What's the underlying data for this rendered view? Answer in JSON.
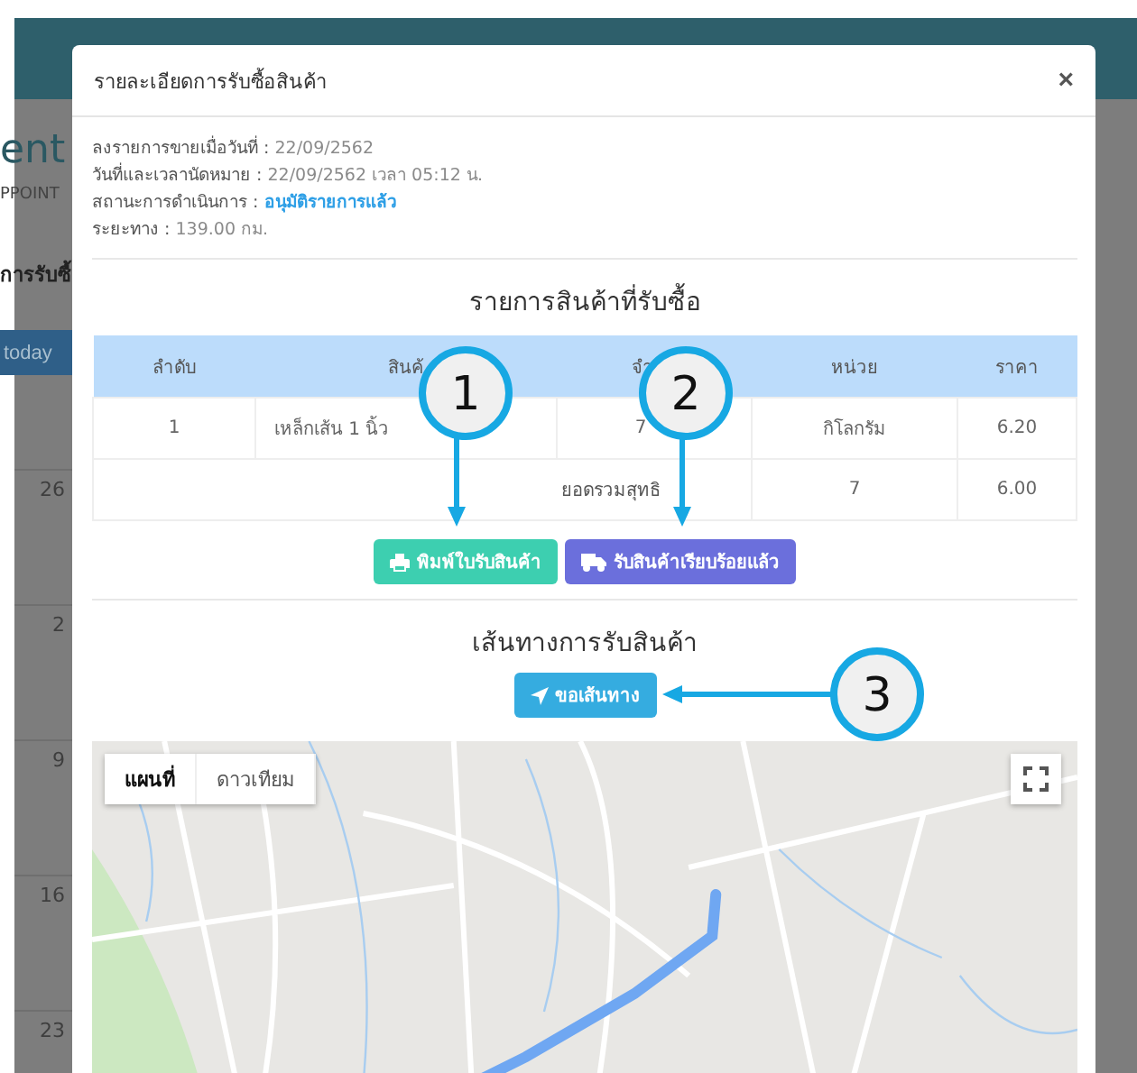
{
  "background_page": {
    "title_fragment": "ent",
    "subtitle_fragment": "PPOINT",
    "heading_fragment": "การรับซื้",
    "today_button": "today",
    "calendar_days": [
      "26",
      "2",
      "9",
      "16",
      "23"
    ]
  },
  "modal": {
    "title": "รายละเอียดการรับซื้อสินค้า",
    "close": "×",
    "info": [
      {
        "label": "ลงรายการขายเมื่อวันที่ :",
        "value": "22/09/2562",
        "kind": "text"
      },
      {
        "label": "วันที่และเวลานัดหมาย :",
        "value": "22/09/2562 เวลา 05:12 น.",
        "kind": "text"
      },
      {
        "label": "สถานะการดำเนินการ :",
        "value": "อนุมัติรายการแล้ว",
        "kind": "status"
      },
      {
        "label": "ระยะทาง :",
        "value": "139.00 กม.",
        "kind": "text"
      }
    ],
    "items_title": "รายการสินค้าที่รับซื้อ",
    "table": {
      "columns": [
        "ลำดับ",
        "สินค้",
        "จำ",
        "หน่วย",
        "ราคา"
      ],
      "rows": [
        {
          "cells": [
            "1",
            "เหล็กเส้น 1 นิ้ว",
            "7",
            "กิโลกรัม",
            "6.20"
          ]
        }
      ],
      "total": {
        "label": "ยอดรวมสุทธิ",
        "quantity": "7",
        "price": "6.00"
      }
    },
    "buttons": [
      {
        "label": "พิมพ์ใบรับสินค้า",
        "kind": "print"
      },
      {
        "label": "รับสินค้าเรียบร้อยแล้ว",
        "kind": "truck"
      }
    ],
    "route_title": "เส้นทางการรับสินค้า",
    "route_button": "ขอเส้นทาง",
    "map": {
      "types": [
        {
          "label": "แผนที่",
          "selected": true
        },
        {
          "label": "ดาวเทียม",
          "selected": false
        }
      ]
    }
  },
  "annotations": [
    "1",
    "2",
    "3"
  ]
}
